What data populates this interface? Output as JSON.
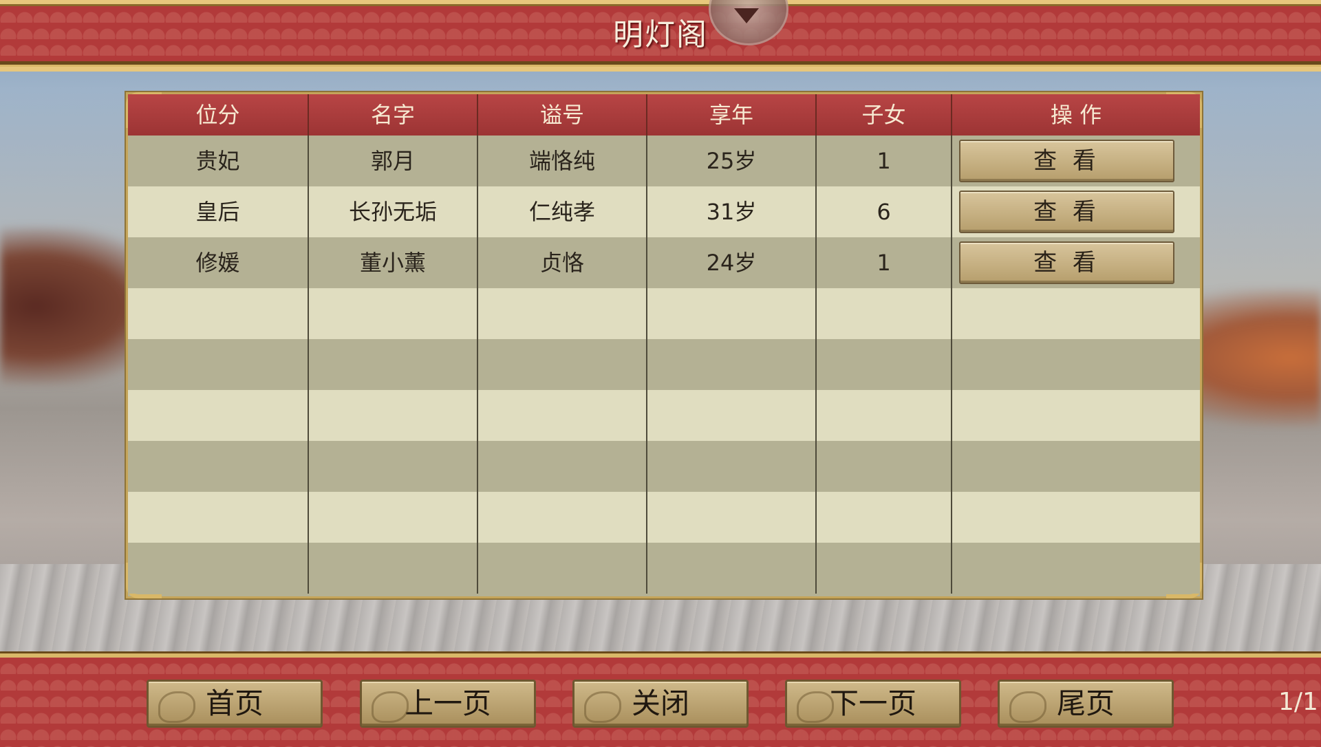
{
  "title": "明灯阁",
  "table": {
    "headers": [
      "位分",
      "名字",
      "谥号",
      "享年",
      "子女",
      "操 作"
    ],
    "rows": [
      {
        "rank": "贵妃",
        "name": "郭月",
        "posthumous": "端恪纯",
        "age": "25岁",
        "children": "1",
        "action": "查 看"
      },
      {
        "rank": "皇后",
        "name": "长孙无垢",
        "posthumous": "仁纯孝",
        "age": "31岁",
        "children": "6",
        "action": "查 看"
      },
      {
        "rank": "修媛",
        "name": "董小薰",
        "posthumous": "贞恪",
        "age": "24岁",
        "children": "1",
        "action": "查 看"
      }
    ]
  },
  "nav": {
    "first": "首页",
    "prev": "上一页",
    "close": "关闭",
    "next": "下一页",
    "last": "尾页"
  },
  "page_indicator": "1/1"
}
